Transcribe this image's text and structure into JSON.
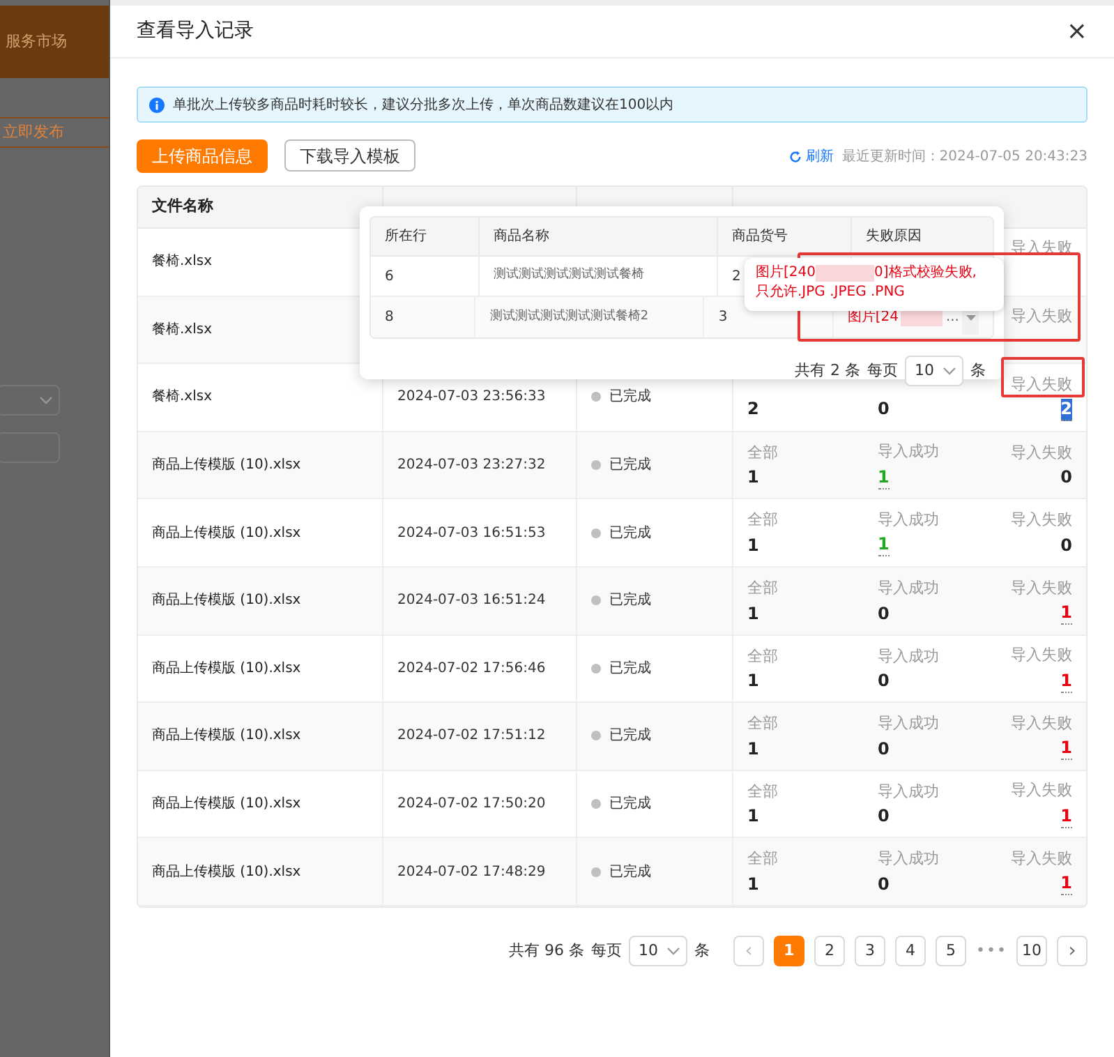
{
  "backdrop": {
    "header_text": "服务市场",
    "publish_button": "立即发布"
  },
  "dialog": {
    "title": "查看导入记录",
    "close": "×"
  },
  "alert": {
    "text": "单批次上传较多商品时耗时较长，建议分批多次上传，单次商品数建议在100以内"
  },
  "toolbar": {
    "upload_button": "上传商品信息",
    "download_button": "下载导入模板",
    "refresh": "刷新",
    "updated": "最近更新时间：2024-07-05 20:43:23"
  },
  "table": {
    "columns": [
      "文件名称"
    ],
    "rows": [
      {
        "file": "餐椅.xlsx",
        "counts": [
          {
            "label": "导入失败",
            "kind": "hidden"
          }
        ]
      },
      {
        "file": "餐椅.xlsx",
        "counts": [
          {
            "label": "导入失败",
            "kind": "hidden"
          }
        ]
      },
      {
        "file": "餐椅.xlsx",
        "time": "2024-07-03 23:56:33",
        "status": "已完成",
        "counts": [
          {
            "value": "2",
            "kind": "plain"
          },
          {
            "value": "0",
            "kind": "plain"
          },
          {
            "label": "导入失败",
            "value": "2",
            "kind": "selected"
          }
        ]
      },
      {
        "file": "商品上传模版 (10).xlsx",
        "time": "2024-07-03 23:27:32",
        "status": "已完成",
        "counts": [
          {
            "label": "全部",
            "value": "1",
            "kind": "plain"
          },
          {
            "label": "导入成功",
            "value": "1",
            "kind": "success"
          },
          {
            "label": "导入失败",
            "value": "0",
            "kind": "plain"
          }
        ]
      },
      {
        "file": "商品上传模版 (10).xlsx",
        "time": "2024-07-03 16:51:53",
        "status": "已完成",
        "counts": [
          {
            "label": "全部",
            "value": "1",
            "kind": "plain"
          },
          {
            "label": "导入成功",
            "value": "1",
            "kind": "success"
          },
          {
            "label": "导入失败",
            "value": "0",
            "kind": "plain"
          }
        ]
      },
      {
        "file": "商品上传模版 (10).xlsx",
        "time": "2024-07-03 16:51:24",
        "status": "已完成",
        "counts": [
          {
            "label": "全部",
            "value": "1",
            "kind": "plain"
          },
          {
            "label": "导入成功",
            "value": "0",
            "kind": "plain"
          },
          {
            "label": "导入失败",
            "value": "1",
            "kind": "error"
          }
        ]
      },
      {
        "file": "商品上传模版 (10).xlsx",
        "time": "2024-07-02 17:56:46",
        "status": "已完成",
        "counts": [
          {
            "label": "全部",
            "value": "1",
            "kind": "plain"
          },
          {
            "label": "导入成功",
            "value": "0",
            "kind": "plain"
          },
          {
            "label": "导入失败",
            "value": "1",
            "kind": "error"
          }
        ]
      },
      {
        "file": "商品上传模版 (10).xlsx",
        "time": "2024-07-02 17:51:12",
        "status": "已完成",
        "counts": [
          {
            "label": "全部",
            "value": "1",
            "kind": "plain"
          },
          {
            "label": "导入成功",
            "value": "0",
            "kind": "plain"
          },
          {
            "label": "导入失败",
            "value": "1",
            "kind": "error"
          }
        ]
      },
      {
        "file": "商品上传模版 (10).xlsx",
        "time": "2024-07-02 17:50:20",
        "status": "已完成",
        "counts": [
          {
            "label": "全部",
            "value": "1",
            "kind": "plain"
          },
          {
            "label": "导入成功",
            "value": "0",
            "kind": "plain"
          },
          {
            "label": "导入失败",
            "value": "1",
            "kind": "error"
          }
        ]
      },
      {
        "file": "商品上传模版 (10).xlsx",
        "time": "2024-07-02 17:48:29",
        "status": "已完成",
        "counts": [
          {
            "label": "全部",
            "value": "1",
            "kind": "plain"
          },
          {
            "label": "导入成功",
            "value": "0",
            "kind": "plain"
          },
          {
            "label": "导入失败",
            "value": "1",
            "kind": "error"
          }
        ]
      }
    ]
  },
  "popover": {
    "columns": [
      "所在行",
      "商品名称",
      "商品货号",
      "失败原因"
    ],
    "rows": [
      {
        "line": "6",
        "name": "测试测试测试测试测试餐椅",
        "code": "2"
      },
      {
        "line": "8",
        "name": "测试测试测试测试测试餐椅2",
        "code": "3",
        "reason_start": "图片[24",
        "reason_end": "..."
      }
    ],
    "tooltip": {
      "start": "图片[240",
      "end": "0]格式校验失败,",
      "line2": "只允许.JPG .JPEG .PNG"
    },
    "pagination": {
      "total": "共有 2 条",
      "per_page_label": "每页",
      "per_page": "10",
      "unit": "条"
    }
  },
  "pagination": {
    "total": "共有 96 条",
    "per_page_label": "每页",
    "per_page": "10",
    "unit": "条",
    "prev": "‹",
    "next": "›",
    "pages": [
      {
        "label": "1",
        "selected": true,
        "kind": "page"
      },
      {
        "label": "2",
        "selected": false,
        "kind": "page"
      },
      {
        "label": "3",
        "selected": false,
        "kind": "page"
      },
      {
        "label": "4",
        "selected": false,
        "kind": "page"
      },
      {
        "label": "5",
        "selected": false,
        "kind": "page"
      },
      {
        "label": "•••",
        "kind": "ellipsis"
      },
      {
        "label": "10",
        "selected": false,
        "kind": "page"
      }
    ]
  }
}
